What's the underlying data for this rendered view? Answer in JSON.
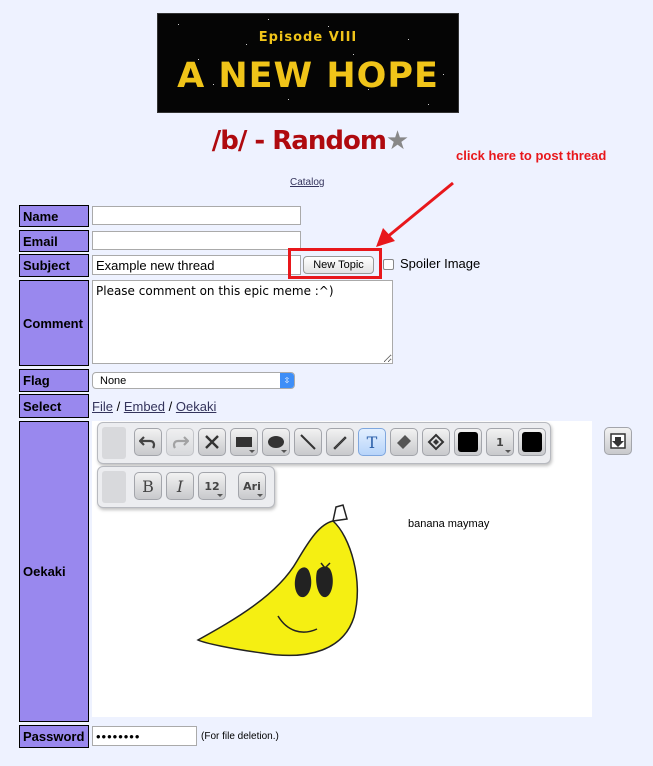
{
  "banner": {
    "episode": "Episode VIII",
    "headline": "A NEW HOPE"
  },
  "board": {
    "title": "/b/ - Random",
    "star_icon": "star-icon"
  },
  "annotation": {
    "text": "click here to post thread",
    "color": "#e8171b"
  },
  "catalog_link": "Catalog",
  "form": {
    "name_label": "Name",
    "email_label": "Email",
    "subject_label": "Subject",
    "comment_label": "Comment",
    "flag_label": "Flag",
    "select_label": "Select",
    "oekaki_label": "Oekaki",
    "password_label": "Password",
    "name_value": "",
    "email_value": "",
    "subject_value": "Example new thread",
    "submit_label": "New Topic",
    "spoiler_label": "Spoiler Image",
    "comment_value": "Please comment on this epic meme :^)",
    "flag_selected": "None",
    "select_file": "File",
    "select_embed": "Embed",
    "select_oekaki": "Oekaki",
    "select_separator": "/",
    "password_value": "••••••••",
    "password_note": "(For file deletion.)"
  },
  "oekaki": {
    "tools_row1": [
      "undo-icon",
      "redo-icon",
      "clear-icon",
      "rectangle-icon",
      "ellipse-icon",
      "line-icon",
      "pencil-icon",
      "text-tool-icon",
      "eraser-icon",
      "fill-icon",
      "stroke-color-swatch",
      "line-width-select",
      "fill-color-swatch",
      "save-icon"
    ],
    "tools_row2": [
      "bold-icon",
      "italic-icon",
      "font-size-select",
      "font-family-select"
    ],
    "text_tool_label": "T",
    "bold_label": "B",
    "italic_label": "I",
    "line_width": "1",
    "font_size": "12",
    "font_family": "Ari",
    "drawing_caption": "banana maymay",
    "banana_color": "#f5ef12"
  },
  "colors": {
    "label_bg": "#9988ee",
    "page_bg": "#eef2ff",
    "title_red": "#af0a0f",
    "banner_yellow": "#f0c419"
  }
}
